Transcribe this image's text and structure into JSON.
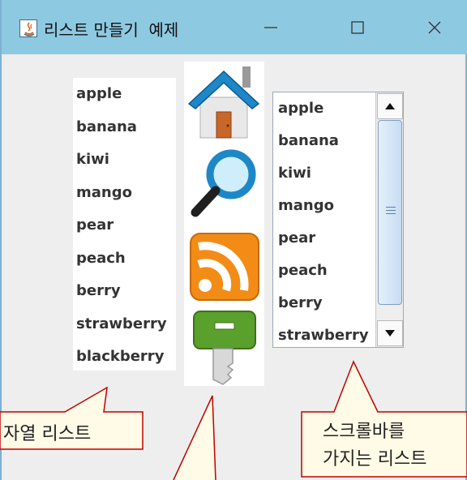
{
  "window": {
    "title": "리스트 만들기  예제",
    "minimize_label": "—",
    "maximize_label": "☐",
    "close_label": "✕"
  },
  "string_list": {
    "items": [
      "apple",
      "banana",
      "kiwi",
      "mango",
      "pear",
      "peach",
      "berry",
      "strawberry",
      "blackberry"
    ]
  },
  "image_list": {
    "icons": [
      "home-icon",
      "search-icon",
      "rss-feed-icon",
      "key-icon"
    ]
  },
  "scroll_list": {
    "items": [
      "apple",
      "banana",
      "kiwi",
      "mango",
      "pear",
      "peach",
      "berry",
      "strawberry"
    ]
  },
  "callouts": {
    "string_list": "자열 리스트",
    "scroll_list_line1": "스크롤바를",
    "scroll_list_line2": "가지는 리스트"
  },
  "colors": {
    "titlebar": "#8ec9e2",
    "window_bg": "#eeeeee",
    "callout_fill": "#fffbe6",
    "callout_stroke": "#c00000"
  }
}
